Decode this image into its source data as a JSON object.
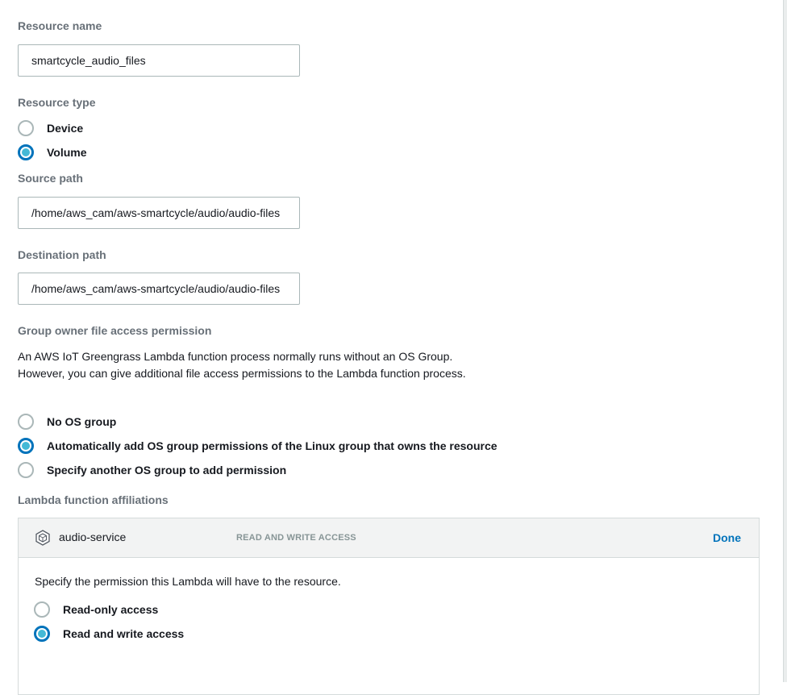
{
  "resource_name": {
    "label": "Resource name",
    "value": "smartcycle_audio_files"
  },
  "resource_type": {
    "label": "Resource type",
    "options": [
      "Device",
      "Volume"
    ],
    "selected": "Volume"
  },
  "source_path": {
    "label": "Source path",
    "value": "/home/aws_cam/aws-smartcycle/audio/audio-files"
  },
  "destination_path": {
    "label": "Destination path",
    "value": "/home/aws_cam/aws-smartcycle/audio/audio-files"
  },
  "group_owner": {
    "label": "Group owner file access permission",
    "description": "An AWS IoT Greengrass Lambda function process normally runs without an OS Group. However, you can give additional file access permissions to the Lambda function process.",
    "options": [
      "No OS group",
      "Automatically add OS group permissions of the Linux group that owns the resource",
      "Specify another OS group to add permission"
    ],
    "selected": "Automatically add OS group permissions of the Linux group that owns the resource"
  },
  "lambda_affiliations": {
    "label": "Lambda function affiliations",
    "function_name": "audio-service",
    "access_badge": "READ AND WRITE ACCESS",
    "done_label": "Done",
    "description": "Specify the permission this Lambda will have to the resource.",
    "options": [
      "Read-only access",
      "Read and write access"
    ],
    "selected": "Read and write access",
    "icon": "lambda-function-icon"
  },
  "colors": {
    "accent": "#0073bb",
    "radio_inner": "#44b9d6",
    "label_gray": "#687078",
    "border": "#aab7b8"
  }
}
